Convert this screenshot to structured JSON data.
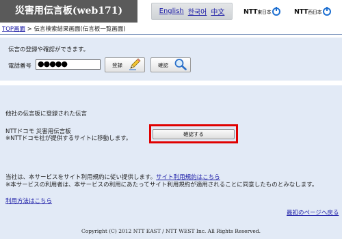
{
  "header": {
    "title": "災害用伝言板(web171)",
    "languages": [
      "English",
      "한국어",
      "中文"
    ],
    "ntt_east": {
      "brand": "NTT",
      "region": "東日本"
    },
    "ntt_west": {
      "brand": "NTT",
      "region": "西日本"
    }
  },
  "breadcrumb": {
    "home_link": "TOP画面",
    "separator": " > ",
    "current": "伝言検索結果画面(伝言板一覧画面)"
  },
  "message_panel": {
    "intro": "伝言の登録や確認ができます。",
    "phone_label": "電話番号",
    "phone_value": "●●●●●",
    "register_button": "登録",
    "confirm_button": "確認"
  },
  "other_boards": {
    "heading": "他社の伝言板に登録された伝言",
    "provider_name": "NTTドコモ 災害用伝言板",
    "provider_note": "※NTTドコモ社が提供するサイトに移動します。",
    "confirm_button": "確認する"
  },
  "terms": {
    "line1_prefix": "当社は、本サービスをサイト利用規約に従い提供します。",
    "terms_link": "サイト利用規約はこちら",
    "line2": "※本サービスの利用者は、本サービスの利用にあたってサイト利用規約が適用されることに同意したものとみなします。",
    "usage_link": "利用方法はこちら",
    "back_link": "最初のページへ戻る"
  },
  "footer": {
    "copyright": "Copyright (C) 2012 NTT EAST / NTT WEST Inc. All Rights Reserved."
  },
  "colors": {
    "title_bg": "#5a5a5a",
    "panel_bg": "#e2eaf6",
    "link": "#1a1aa6",
    "highlight_frame": "#e00000",
    "ntt_logo_blue": "#1d6fd1"
  },
  "icons": {
    "register": "pencil-icon",
    "confirm": "magnifier-icon"
  }
}
